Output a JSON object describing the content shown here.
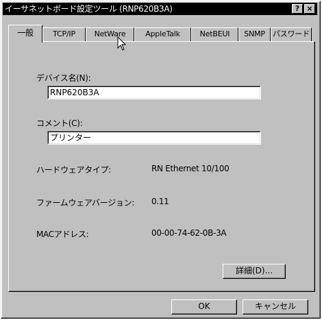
{
  "window": {
    "title": "イーサネットボード設定ツール (RNP620B3A)",
    "help_button": "?",
    "close_button": "×"
  },
  "tabs": [
    {
      "label": "一般"
    },
    {
      "label": "TCP/IP"
    },
    {
      "label": "NetWare"
    },
    {
      "label": "AppleTalk"
    },
    {
      "label": "NetBEUI"
    },
    {
      "label": "SNMP"
    },
    {
      "label": "パスワード"
    }
  ],
  "general": {
    "device_name_label": "デバイス名(N):",
    "device_name_value": "RNP620B3A",
    "comment_label": "コメント(C):",
    "comment_value": "プリンター",
    "hardware_type_label": "ハードウェアタイプ:",
    "hardware_type_value": "RN Ethernet 10/100",
    "firmware_version_label": "ファームウェアバージョン:",
    "firmware_version_value": "0.11",
    "mac_address_label": "MACアドレス:",
    "mac_address_value": "00-00-74-62-0B-3A",
    "details_button": "詳細(D)..."
  },
  "footer": {
    "ok_button": "OK",
    "cancel_button": "キャンセル"
  },
  "icons": {
    "cursor": "arrow-cursor-icon"
  }
}
